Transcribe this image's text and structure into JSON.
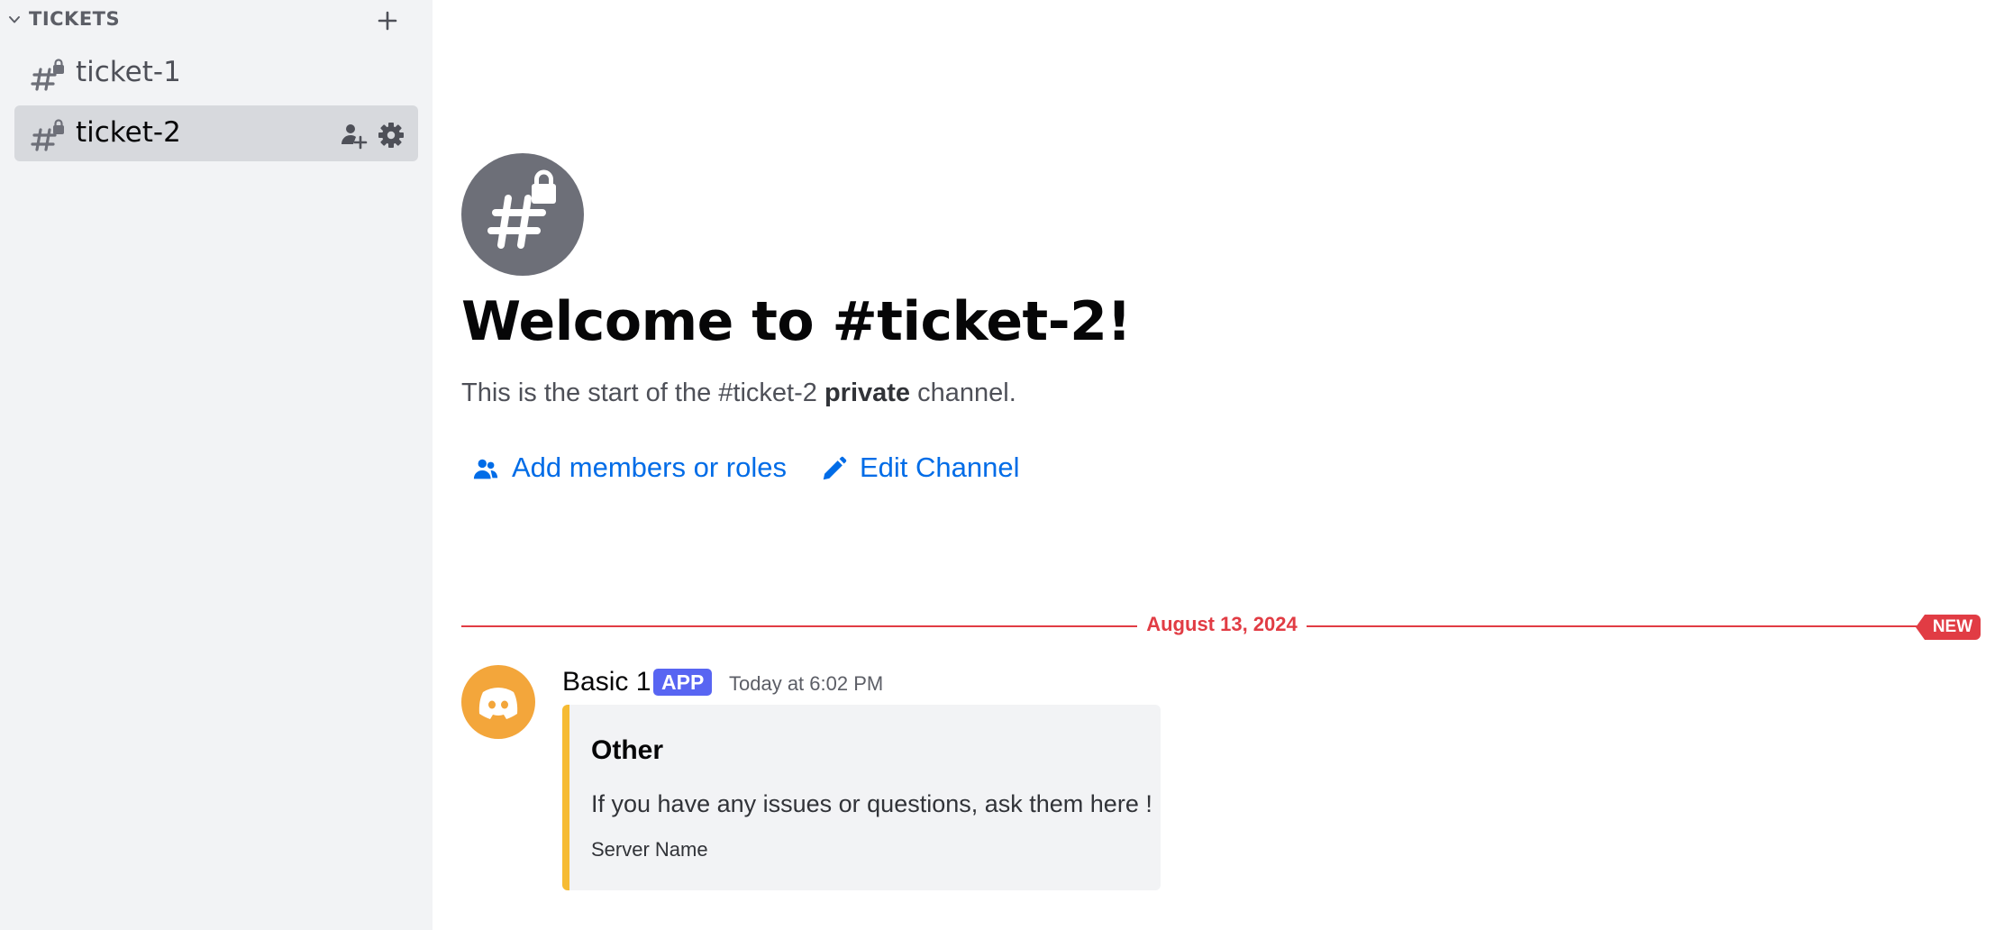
{
  "sidebar": {
    "category": {
      "label": "TICKETS"
    },
    "channels": [
      {
        "name": "ticket-1",
        "selected": false
      },
      {
        "name": "ticket-2",
        "selected": true
      }
    ]
  },
  "main": {
    "welcome_title": "Welcome to #ticket-2!",
    "subtitle": {
      "prefix": "This is the start of the #ticket-2 ",
      "bold": "private",
      "suffix": " channel."
    },
    "actions": {
      "add_members": "Add members or roles",
      "edit_channel": "Edit Channel"
    },
    "divider": {
      "date": "August 13, 2024",
      "new_label": "NEW"
    },
    "message": {
      "author": "Basic 1",
      "badge": "APP",
      "timestamp": "Today at 6:02 PM",
      "embed": {
        "title": "Other",
        "description": "If you have any issues or questions, ask them here !",
        "footer": "Server Name"
      }
    }
  },
  "colors": {
    "sidebar_bg": "#f2f3f5",
    "selected_bg": "#d7d9dd",
    "link": "#006ce7",
    "divider": "#e13c44",
    "app_badge": "#5865f2",
    "embed_accent": "#f6bb33",
    "avatar": "#f3a63b"
  },
  "icons": {
    "category_chevron": "chevron-down-icon",
    "create_channel": "plus-icon",
    "channel": "hashtag-lock-icon",
    "invite": "add-member-icon",
    "settings": "gear-icon",
    "edit": "pencil-icon",
    "avatar": "discord-logo-icon"
  }
}
